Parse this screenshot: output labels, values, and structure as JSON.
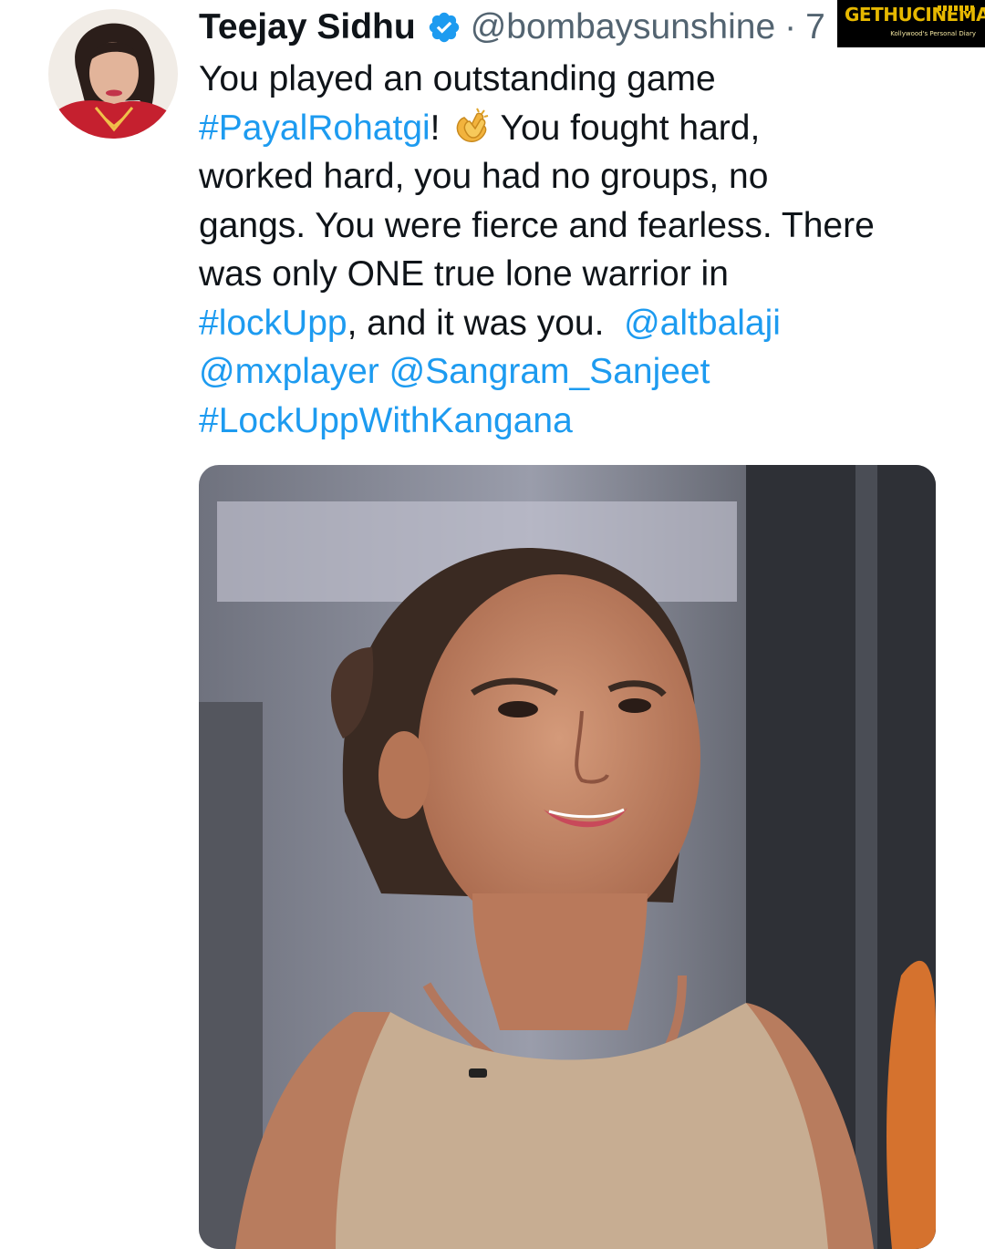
{
  "tweet": {
    "author": {
      "display_name": "Teejay Sidhu",
      "handle": "@bombaysunshine",
      "verified": true
    },
    "separator": "·",
    "time": "7",
    "lines": [
      [
        {
          "t": "You played an outstanding game",
          "k": "text"
        }
      ],
      [
        {
          "t": "#PayalRohatgi",
          "k": "link"
        },
        {
          "t": "!",
          "k": "text"
        },
        {
          "t": "👏",
          "k": "emoji"
        },
        {
          "t": "You fought hard,",
          "k": "text"
        }
      ],
      [
        {
          "t": "worked hard, you had no groups, no",
          "k": "text"
        }
      ],
      [
        {
          "t": "gangs. You were fierce and fearless. There",
          "k": "text"
        }
      ],
      [
        {
          "t": "was only ONE true lone warrior in",
          "k": "text"
        }
      ],
      [
        {
          "t": "#lockUpp",
          "k": "link"
        },
        {
          "t": ", and it was you.  ",
          "k": "text"
        },
        {
          "t": "@altbalaji",
          "k": "link"
        }
      ],
      [
        {
          "t": "@mxplayer",
          "k": "link"
        },
        {
          "t": " ",
          "k": "text"
        },
        {
          "t": "@Sangram_Sanjeet",
          "k": "link"
        }
      ],
      [
        {
          "t": "#LockUppWithKangana",
          "k": "link"
        }
      ]
    ],
    "emoji_name": "clapping-hands-icon",
    "media": {
      "kind": "photo"
    }
  },
  "watermark": {
    "title": "GETHUCINEMA",
    "tagline": "Kollywood's Personal Diary"
  },
  "colors": {
    "link": "#1d9bf0",
    "text": "#0f1419",
    "muted": "#536471",
    "verified": "#1d9bf0",
    "watermark_bg": "#000000",
    "watermark_text": "#e6b800"
  }
}
